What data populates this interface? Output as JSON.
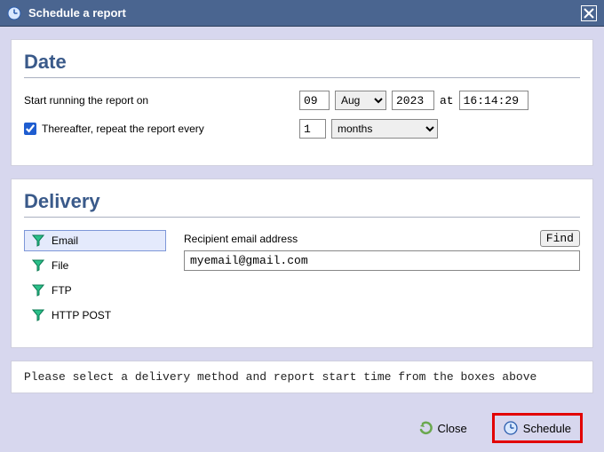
{
  "titlebar": {
    "title": "Schedule a report",
    "close_tooltip": "Close"
  },
  "date": {
    "heading": "Date",
    "start_label": "Start running the report on",
    "day": "09",
    "month": "Aug",
    "year": "2023",
    "at_label": "at",
    "time": "16:14:29",
    "repeat_checked": true,
    "repeat_label": "Thereafter, repeat the report every",
    "repeat_count": "1",
    "repeat_unit": "months"
  },
  "delivery": {
    "heading": "Delivery",
    "methods": [
      {
        "label": "Email",
        "selected": true
      },
      {
        "label": "File",
        "selected": false
      },
      {
        "label": "FTP",
        "selected": false
      },
      {
        "label": "HTTP POST",
        "selected": false
      }
    ],
    "recipient_label": "Recipient email address",
    "find_label": "Find",
    "email_value": "myemail@gmail.com"
  },
  "hint": "Please select a delivery method and report start time from the boxes above",
  "footer": {
    "close_label": "Close",
    "schedule_label": "Schedule"
  }
}
